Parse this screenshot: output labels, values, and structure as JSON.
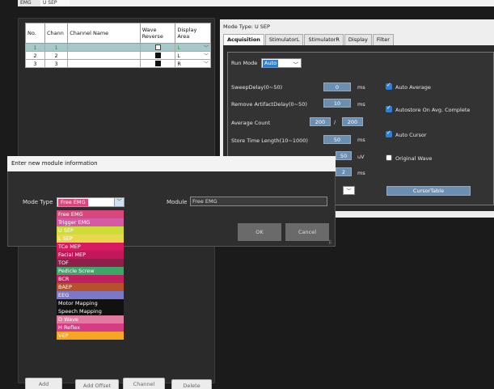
{
  "window": {
    "tabs": [
      "EMG",
      "U SEP"
    ]
  },
  "channels": {
    "headers": [
      "No.",
      "Chann",
      "Channel Name",
      "Wave Reverse",
      "Display Area"
    ],
    "rows": [
      {
        "no": "1",
        "chan": "1",
        "name": "",
        "reverse": false,
        "area": "L"
      },
      {
        "no": "2",
        "chan": "2",
        "name": "",
        "reverse": true,
        "area": "L"
      },
      {
        "no": "3",
        "chan": "3",
        "name": "",
        "reverse": true,
        "area": "R"
      }
    ]
  },
  "bottom_buttons": [
    "Add",
    "Add Offset",
    "Channel",
    "Delete"
  ],
  "mode_type_header": "Mode Type: U SEP",
  "settings_tabs": [
    "Acquisition",
    "StimulatorL",
    "StimulatorR",
    "Display",
    "Filter"
  ],
  "acquisition": {
    "run_mode_label": "Run Mode",
    "run_mode_value": "Auto",
    "sweep_delay_label": "SweepDelay(0~50)",
    "sweep_delay_value": "0",
    "sweep_delay_unit": "ms",
    "remove_artifact_label": "Remove ArtifactDelay(0~50)",
    "remove_artifact_value": "10",
    "remove_artifact_unit": "ms",
    "avg_count_label": "Average Count",
    "avg_count_value": "200",
    "avg_count_sep": "/",
    "avg_count_total": "200",
    "store_time_label": "Store Time Length(10~1000)",
    "store_time_value": "50",
    "store_time_unit": "ms",
    "sens_value": "50",
    "sens_unit": "uV",
    "time_value": "2",
    "time_unit": "ms",
    "cursor_table": "CursorTable",
    "auto_average": "Auto Average",
    "autostore": "Autostore On Avg. Complete",
    "auto_cursor": "Auto Cursor",
    "original_wave": "Original Wave"
  },
  "dialog": {
    "title": "Enter new module information",
    "mode_type_label": "Mode Type",
    "mode_type_value": "Free EMG",
    "module_label": "Module",
    "module_value": "Free EMG",
    "ok": "OK",
    "cancel": "Cancel"
  },
  "dropdown_options": [
    {
      "label": "Free EMG",
      "color": "#d9477d"
    },
    {
      "label": "Trigger EMG",
      "color": "#d45aa6"
    },
    {
      "label": "U SEP",
      "color": "#cddc39"
    },
    {
      "label": "L SEP",
      "color": "#e8d84e"
    },
    {
      "label": "TCe MEP",
      "color": "#d81b60"
    },
    {
      "label": "Facial MEP",
      "color": "#c2185b"
    },
    {
      "label": "TOF",
      "color": "#8e1f4a"
    },
    {
      "label": "Pedicle Screw",
      "color": "#3fa66a"
    },
    {
      "label": "BCR",
      "color": "#c0205f"
    },
    {
      "label": "BAEP",
      "color": "#b5522d"
    },
    {
      "label": "EEG",
      "color": "#7b78c8"
    },
    {
      "label": "Motor Mapping",
      "color": "#111111"
    },
    {
      "label": "Speech Mapping",
      "color": "#111111"
    },
    {
      "label": "D Wave",
      "color": "#e07aa0"
    },
    {
      "label": "H Reflex",
      "color": "#d63b86"
    },
    {
      "label": "VEP",
      "color": "#f5a623"
    }
  ],
  "colors": {
    "accent": "#2f7fd6",
    "input_bg": "#6b8fb3",
    "selection": "#a7c8c8"
  }
}
